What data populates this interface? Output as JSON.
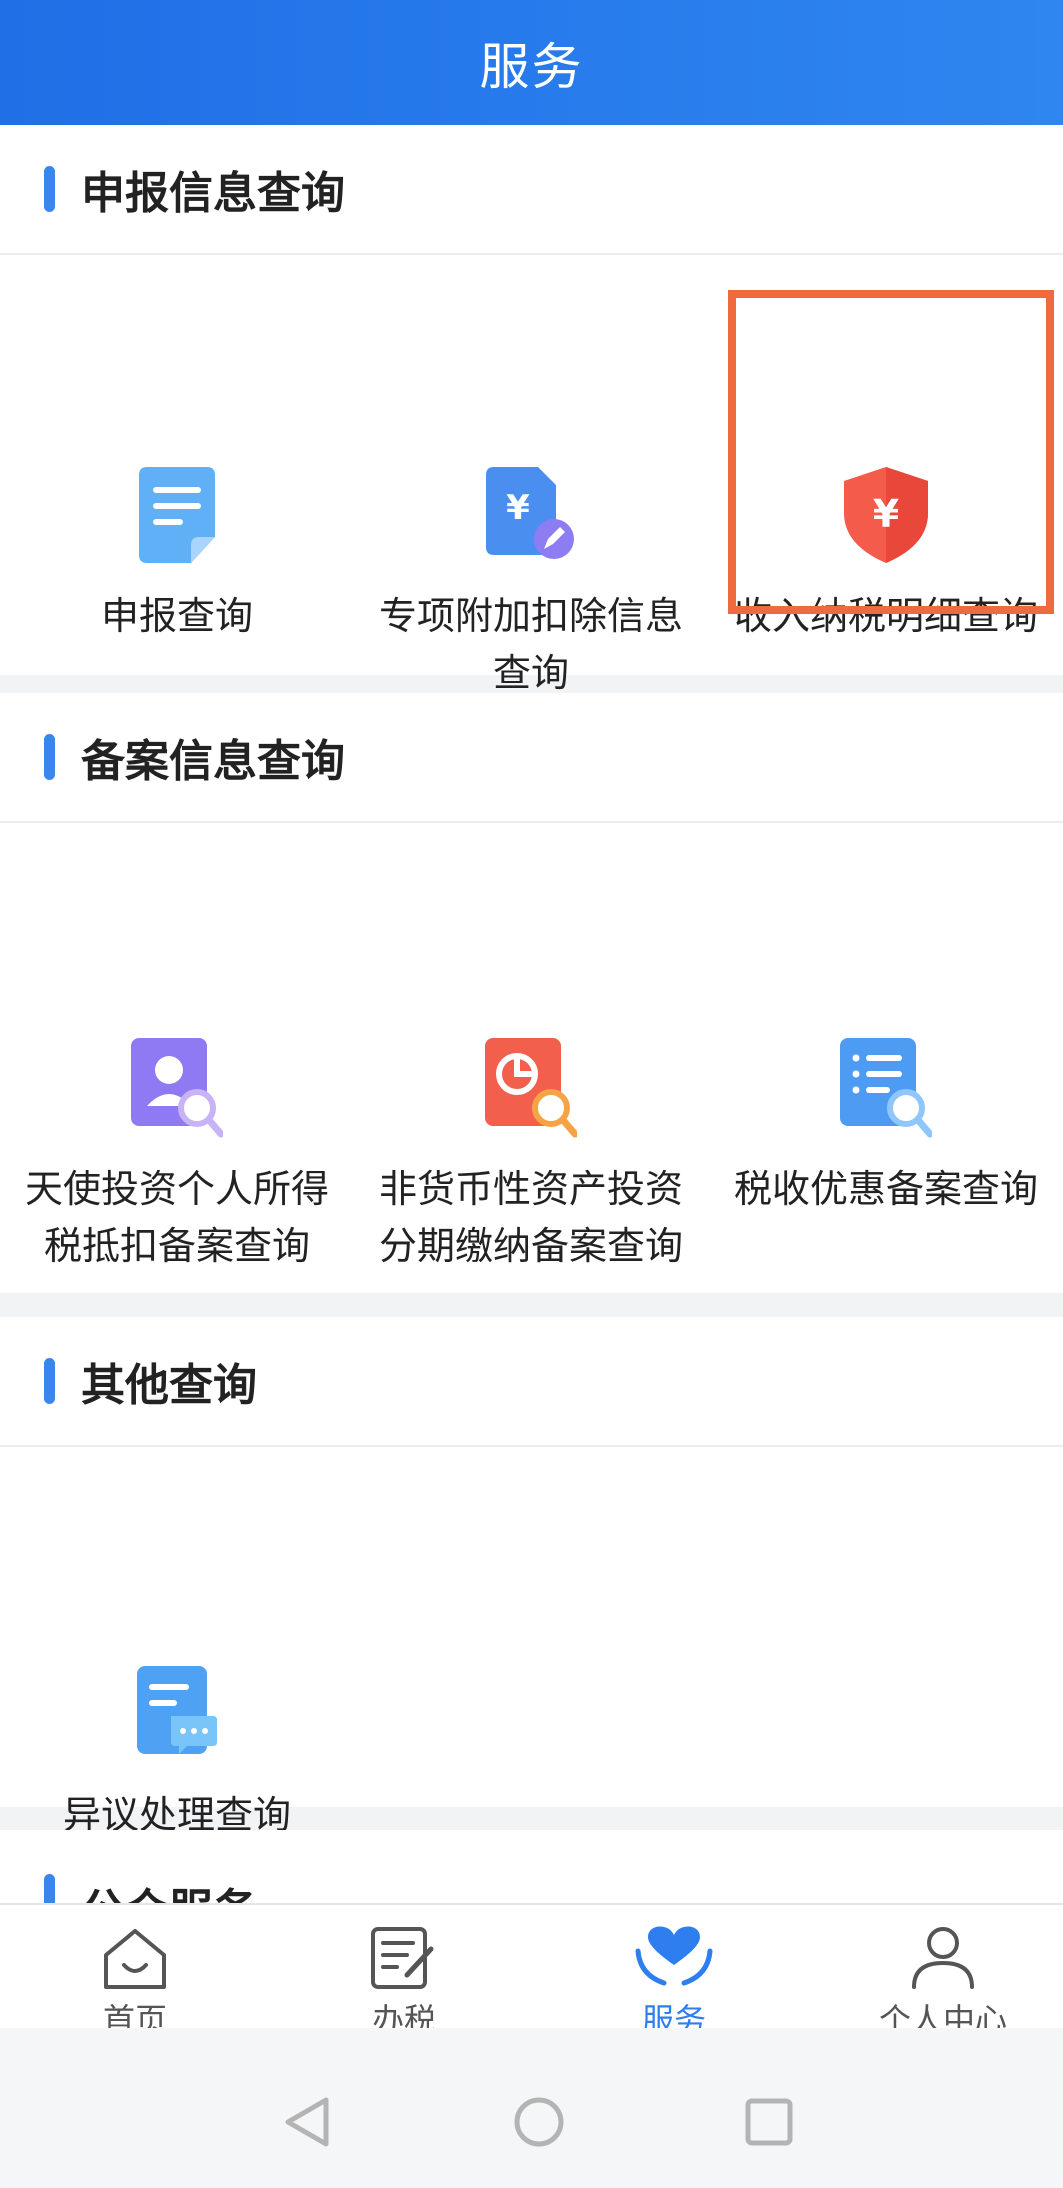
{
  "header": {
    "title": "服务"
  },
  "sections": [
    {
      "title": "申报信息查询",
      "items": [
        {
          "label": "申报查询",
          "icon": "document-icon"
        },
        {
          "label": "专项附加扣除信息查询",
          "icon": "yuan-edit-icon"
        },
        {
          "label": "收入纳税明细查询",
          "icon": "yuan-shield-icon"
        }
      ]
    },
    {
      "title": "备案信息查询",
      "items": [
        {
          "label": "天使投资个人所得税抵扣备案查询",
          "icon": "person-search-icon"
        },
        {
          "label": "非货币性资产投资分期缴纳备案查询",
          "icon": "chart-search-icon"
        },
        {
          "label": "税收优惠备案查询",
          "icon": "list-search-icon"
        }
      ]
    },
    {
      "title": "其他查询",
      "items": [
        {
          "label": "异议处理查询",
          "icon": "doc-message-icon"
        }
      ]
    },
    {
      "title": "公众服务"
    }
  ],
  "bottom_nav": {
    "items": [
      {
        "label": "首页",
        "icon": "home-icon"
      },
      {
        "label": "办税",
        "icon": "edit-doc-icon"
      },
      {
        "label": "服务",
        "icon": "heart-hands-icon",
        "active": true
      },
      {
        "label": "个人中心",
        "icon": "person-icon"
      }
    ]
  },
  "colors": {
    "header": "#2f86f0",
    "accent": "#3a86ef",
    "highlight": "#f06a3f"
  }
}
